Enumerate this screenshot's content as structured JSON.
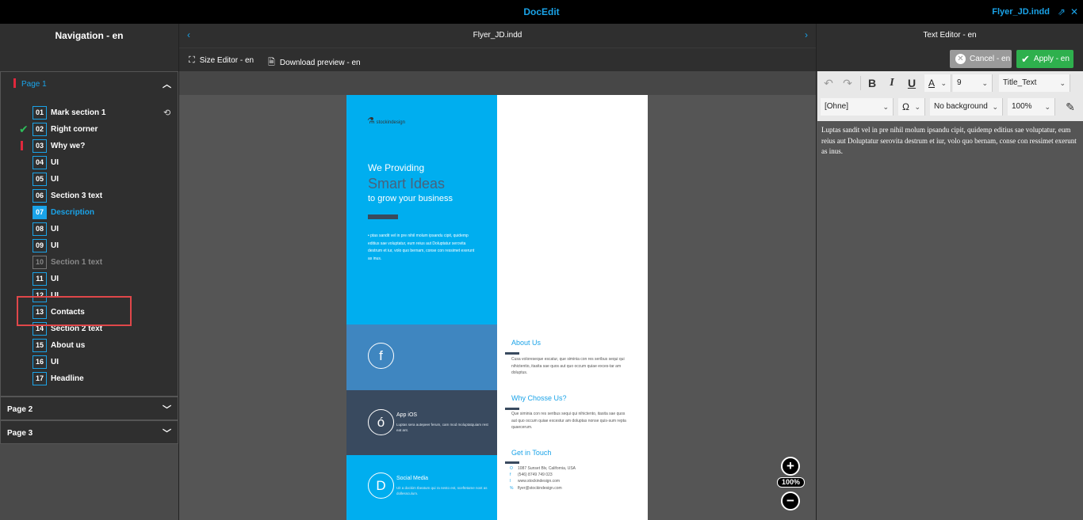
{
  "app": {
    "title": "DocEdit",
    "file_name": "Flyer_JD.indd"
  },
  "navigation": {
    "title": "Navigation - en",
    "pages": [
      {
        "label": "Page 1",
        "expanded": true
      },
      {
        "label": "Page 2",
        "expanded": false
      },
      {
        "label": "Page 3",
        "expanded": false
      }
    ],
    "items": [
      {
        "num": "01",
        "label": "Mark section 1"
      },
      {
        "num": "02",
        "label": "Right corner"
      },
      {
        "num": "03",
        "label": "Why we?"
      },
      {
        "num": "04",
        "label": "UI"
      },
      {
        "num": "05",
        "label": "UI"
      },
      {
        "num": "06",
        "label": "Section 3 text"
      },
      {
        "num": "07",
        "label": "Description"
      },
      {
        "num": "08",
        "label": "UI"
      },
      {
        "num": "09",
        "label": "UI"
      },
      {
        "num": "10",
        "label": "Section 1 text"
      },
      {
        "num": "11",
        "label": "UI"
      },
      {
        "num": "12",
        "label": "UI"
      },
      {
        "num": "13",
        "label": "Contacts"
      },
      {
        "num": "14",
        "label": "Section 2 text"
      },
      {
        "num": "15",
        "label": "About us"
      },
      {
        "num": "16",
        "label": "UI"
      },
      {
        "num": "17",
        "label": "Headline"
      }
    ]
  },
  "document": {
    "title": "Flyer_JD.indd",
    "size_editor": "Size Editor - en",
    "download_preview": "Download preview - en",
    "zoom": "100%"
  },
  "flyer": {
    "logo": "stockindesign",
    "we_providing": "We Providing",
    "smart_ideas": "Smart Ideas",
    "grow": "to grow your business",
    "body": "• ptas sandit vel in pre nihil molum ipsandu cipit, quidemp editius sae voluptatur, eum reius aut Doluptatur serovita destrum et iur, volo quo bernam, conse con ressimet exerunt as inus.",
    "fb_icon": "f",
    "ios_icon": "ó",
    "ios_title": "App iOS",
    "ios_text": "Luptas sera autepeer ferum, cam mod moluptatquiam rest eat ant.",
    "social_icon": "D",
    "social_title": "Social Media",
    "social_text": "Uit a dockim tbeatum qui ra nesto est, sceftetame nost as dollessculum.",
    "about_title": "About Us",
    "about_text": "Cusa voloreseque escatur, que siminia con res seribus sequi qui nihictentio, itasita sae quos aut quo occum quiae exces-tar am doluptus.",
    "why_title": "Why Chosse Us?",
    "why_text": "Que siminia con res seribus sequi qui nihictento, itasita sae quos aut quo occum quiae excestur am doluptas nonse quis-sum repta quaecerum.",
    "touch_title": "Get in Touch",
    "contacts": [
      {
        "icon": "O",
        "text": "1087 Sunset Blv, California, USA"
      },
      {
        "icon": "f",
        "text": "(546) 8749 749 023"
      },
      {
        "icon": "l",
        "text": "www.stockindesign.com"
      },
      {
        "icon": "%",
        "text": "flyer@stockindesign.com"
      }
    ]
  },
  "text_editor": {
    "title": "Text Editor - en",
    "cancel": "Cancel - en",
    "apply": "Apply - en",
    "font_size": "9",
    "style": "Title_Text",
    "paragraph": "[Ohne]",
    "background": "No background",
    "scale": "100%",
    "content": "Luptas sandit vel in pre nihil molum ipsandu cipit, quidemp editius sae voluptatur, eum reius aut Doluptatur serovita destrum et iur, volo quo bernam, conse con ressimet exerunt as inus."
  }
}
